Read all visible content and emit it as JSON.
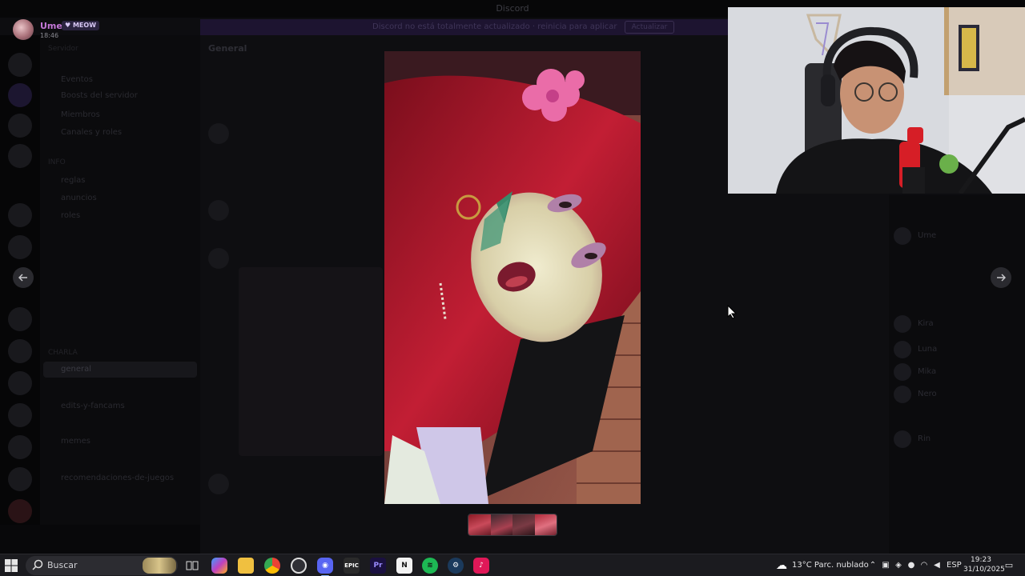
{
  "window": {
    "title": "Discord"
  },
  "notice": {
    "text": "Discord no está totalmente actualizado · reinicia para aplicar",
    "button": "Actualizar"
  },
  "user": {
    "name": "Ume",
    "tag": "MEOW",
    "time": "18:46"
  },
  "channels": {
    "header": "Servidor",
    "items": [
      {
        "label": "Eventos",
        "cat": false
      },
      {
        "label": "Boosts del servidor",
        "cat": false
      },
      {
        "label": "Miembros",
        "cat": false
      },
      {
        "label": "Canales y roles",
        "cat": false
      },
      {
        "label": "INFO",
        "cat": true
      },
      {
        "label": "reglas",
        "cat": false
      },
      {
        "label": "anuncios",
        "cat": false
      },
      {
        "label": "roles",
        "cat": false
      },
      {
        "label": "CHARLA",
        "cat": true
      },
      {
        "label": "general",
        "cat": false,
        "active": true
      },
      {
        "label": "edits-y-fancams",
        "cat": false
      },
      {
        "label": "memes",
        "cat": false
      },
      {
        "label": "recomendaciones-de-juegos",
        "cat": false
      }
    ]
  },
  "chat": {
    "title": "General"
  },
  "members": [
    "Ume",
    "Kira",
    "Luna",
    "Mika",
    "Nero",
    "Rin"
  ],
  "thumbnails": 4,
  "taskbar": {
    "search_placeholder": "Buscar",
    "apps": [
      "Task View",
      "Copilot",
      "Explorer",
      "Chrome",
      "OBS",
      "Discord",
      "Epic",
      "Premiere",
      "Notion",
      "Spotify",
      "Steam",
      "TikTok"
    ],
    "weather": "13°C  Parc. nublado",
    "lang": "ESP",
    "time": "19:23",
    "date": "31/10/2025"
  },
  "colors": {
    "accent": "#5865f2",
    "username": "#c477d8",
    "taskbar_bg": "#1b1b1f"
  }
}
